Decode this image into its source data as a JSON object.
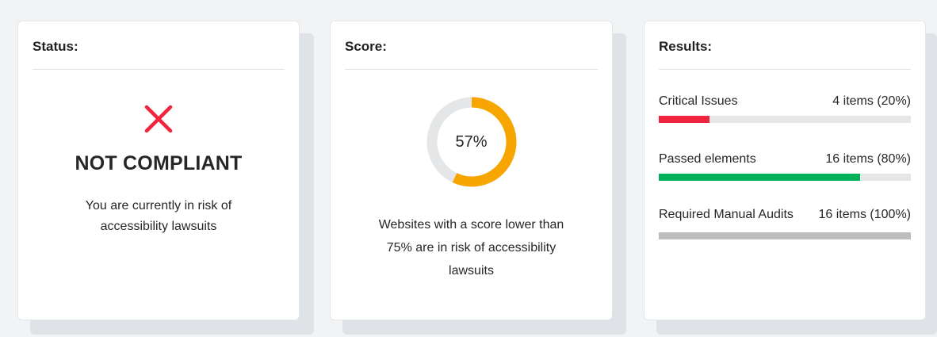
{
  "status": {
    "title": "Status:",
    "icon": "cross-icon",
    "icon_color": "#f0243f",
    "headline": "NOT COMPLIANT",
    "message_line1": "You are currently in risk of",
    "message_line2": "accessibility lawsuits"
  },
  "score": {
    "title": "Score:",
    "value_percent": 57,
    "value_label": "57%",
    "gauge_color": "#f7a600",
    "gauge_track_color": "#e4e6e8",
    "message_line1": "Websites with a score lower than",
    "message_line2": "75% are in risk of accessibility",
    "message_line3": "lawsuits"
  },
  "results": {
    "title": "Results:",
    "items": [
      {
        "label": "Critical Issues",
        "value": "4 items (20%)",
        "fill_percent": 20,
        "color": "#f0243f"
      },
      {
        "label": "Passed elements",
        "value": "16 items (80%)",
        "fill_percent": 80,
        "color": "#00b15a"
      },
      {
        "label": "Required Manual Audits",
        "value": "16 items (100%)",
        "fill_percent": 100,
        "color": "#bdbdbd"
      }
    ]
  }
}
